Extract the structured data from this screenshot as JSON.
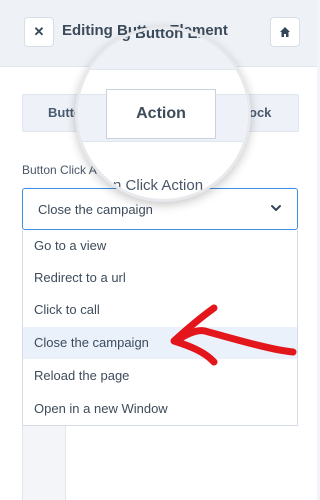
{
  "header": {
    "title": "Editing Button Element",
    "close_icon": "close-icon",
    "home_icon": "home-icon"
  },
  "tabs": [
    {
      "label": "Button"
    },
    {
      "label": "Action",
      "active": true
    },
    {
      "label": "Block"
    }
  ],
  "field": {
    "label": "Button Click Action",
    "help_icon": "question-icon"
  },
  "select": {
    "value": "Close the campaign",
    "chevron_icon": "chevron-down-icon"
  },
  "options": [
    {
      "label": "Go to a view"
    },
    {
      "label": "Redirect to a url"
    },
    {
      "label": "Click to call"
    },
    {
      "label": "Close the campaign",
      "selected": true
    },
    {
      "label": "Reload the page"
    },
    {
      "label": "Open in a new Window"
    }
  ],
  "annotation": {
    "arrow_color": "#e3161b"
  },
  "colors": {
    "accent_border": "#3d8fe0",
    "selected_bg": "#eaf1fb"
  }
}
